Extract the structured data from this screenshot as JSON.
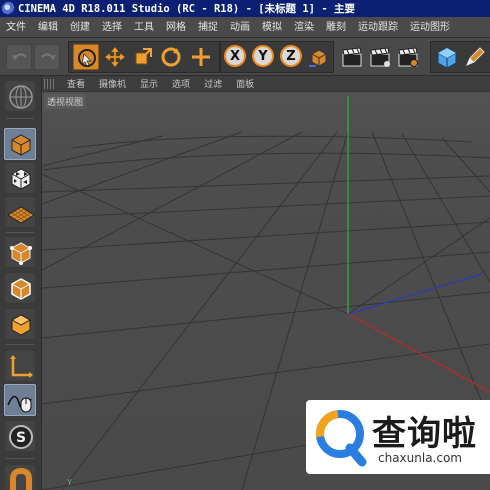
{
  "window": {
    "title": "CINEMA 4D R18.011 Studio (RC - R18) - [未标题 1] - 主要"
  },
  "menu": {
    "items": [
      "文件",
      "编辑",
      "创建",
      "选择",
      "工具",
      "网格",
      "捕捉",
      "动画",
      "模拟",
      "渲染",
      "雕刻",
      "运动跟踪",
      "运动图形"
    ]
  },
  "toolbar": {
    "axis_x": "X",
    "axis_y": "Y",
    "axis_z": "Z",
    "icons": [
      "undo-icon",
      "redo-icon",
      "live-select-icon",
      "move-icon",
      "scale-icon",
      "rotate-icon",
      "recent-tool-icon",
      "lock-x-icon",
      "lock-y-icon",
      "lock-z-icon",
      "coordinate-system-icon",
      "render-view-icon",
      "render-picture-viewer-icon",
      "edit-render-settings-icon",
      "cube-icon",
      "pen-icon"
    ]
  },
  "left_tools": {
    "icons": [
      "make-editable-icon",
      "model-mode-icon",
      "texture-mode-icon",
      "workplane-mode-icon",
      "points-mode-icon",
      "edges-mode-icon",
      "polygons-mode-icon",
      "axis-mode-icon",
      "tweak-mode-icon",
      "snap-icon",
      "magnet-icon"
    ]
  },
  "viewport": {
    "menu": [
      "查看",
      "摄像机",
      "显示",
      "选项",
      "过滤",
      "面板"
    ],
    "label": "透视视图",
    "axis_y_label": "Y"
  },
  "colors": {
    "title_bar": "#0b1f73",
    "accent_orange": "#d8872a",
    "viewport_bg": "#4c4c4c",
    "grid_line": "#2e2e2e",
    "axis_y": "#2fb52f",
    "axis_x": "#c02828",
    "axis_z": "#2a3bb8"
  },
  "watermark": {
    "text": "查询啦",
    "url": "chaxunla.com"
  }
}
